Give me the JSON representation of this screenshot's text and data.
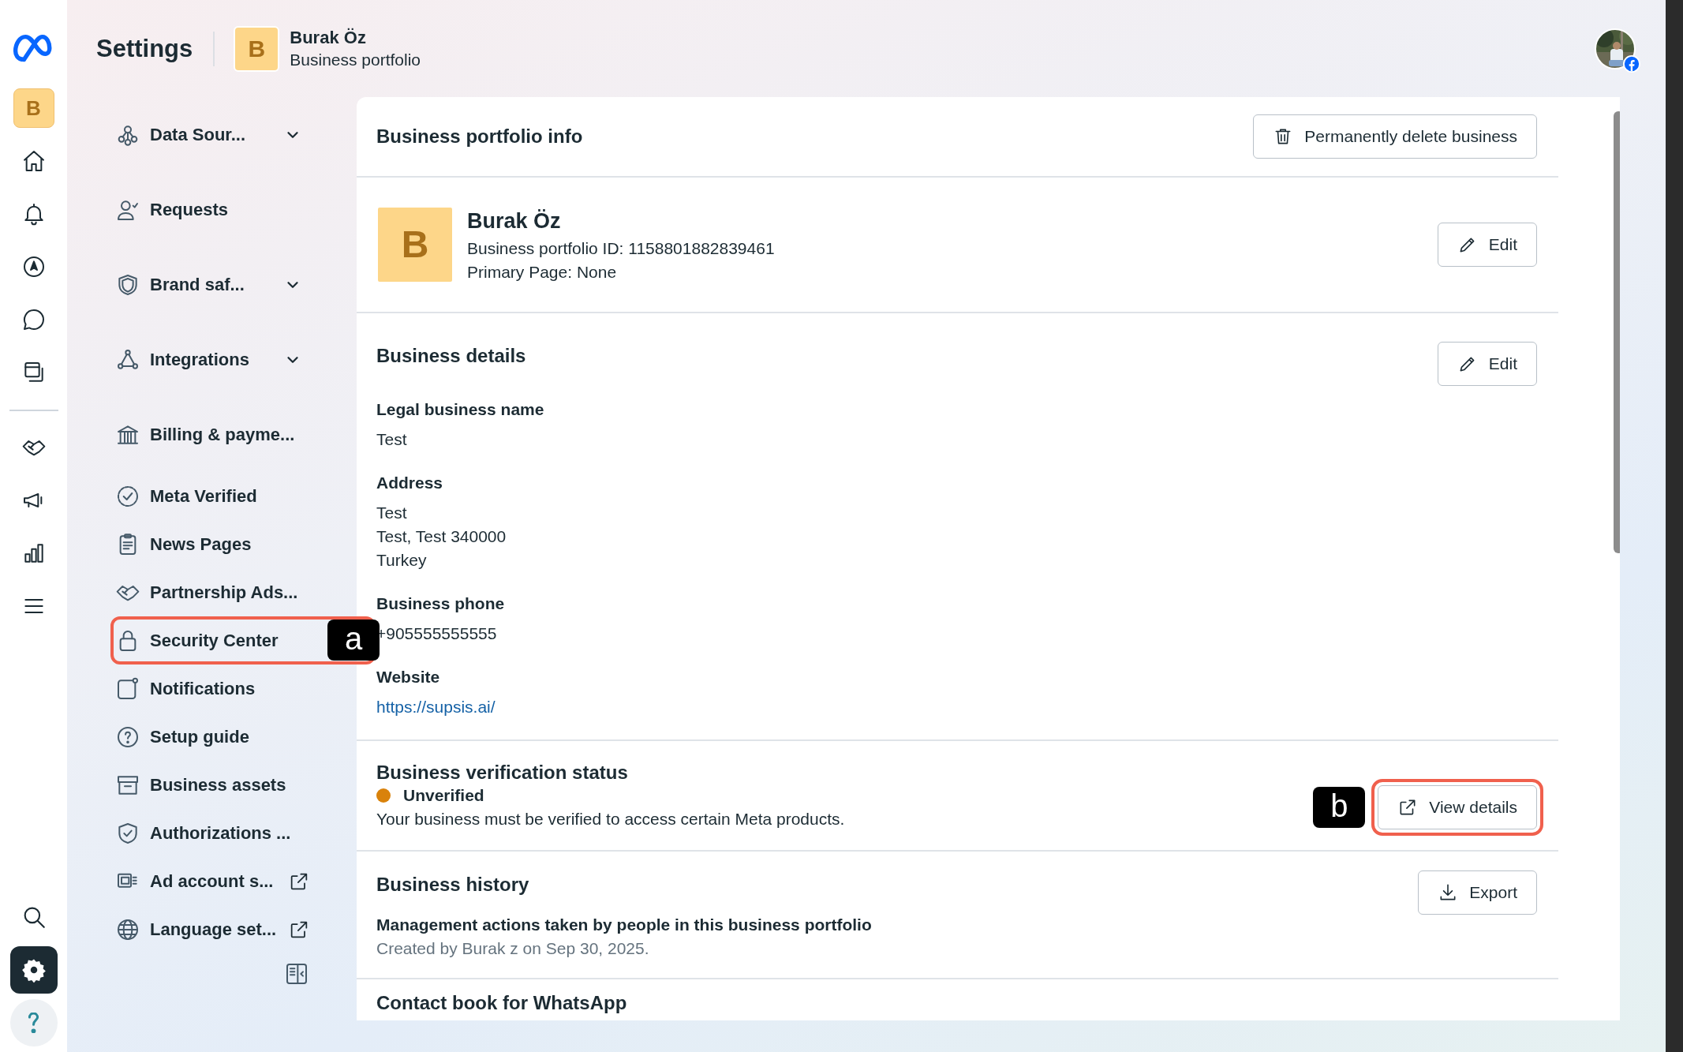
{
  "rail": {
    "badge": "B",
    "items": [
      {
        "selected": false
      },
      {
        "selected": false
      },
      {
        "selected": false
      },
      {
        "selected": false
      },
      {
        "selected": false
      },
      {
        "selected": false
      },
      {
        "selected": false
      },
      {
        "selected": false
      },
      {
        "selected": false
      }
    ],
    "bottom_items": [
      {
        "selected": false
      },
      {
        "selected": true
      },
      {
        "selected": false
      }
    ]
  },
  "header": {
    "title": "Settings",
    "business": {
      "initial": "B",
      "name": "Burak Öz",
      "subtitle": "Business portfolio"
    }
  },
  "sidebar": {
    "items": [
      {
        "label": "Data Sour...",
        "expandable": true,
        "external": false,
        "highlighted": false
      },
      {
        "label": "Requests",
        "expandable": false,
        "external": false,
        "highlighted": false
      },
      {
        "label": "Brand saf...",
        "expandable": true,
        "external": false,
        "highlighted": false
      },
      {
        "label": "Integrations",
        "expandable": true,
        "external": false,
        "highlighted": false
      },
      {
        "label": "Billing & payme...",
        "expandable": false,
        "external": false,
        "highlighted": false
      },
      {
        "label": "Meta Verified",
        "expandable": false,
        "external": false,
        "highlighted": false
      },
      {
        "label": "News Pages",
        "expandable": false,
        "external": false,
        "highlighted": false
      },
      {
        "label": "Partnership Ads...",
        "expandable": false,
        "external": false,
        "highlighted": false
      },
      {
        "label": "Security Center",
        "expandable": false,
        "external": false,
        "highlighted": true,
        "callout": "a"
      },
      {
        "label": "Notifications",
        "expandable": false,
        "external": false,
        "highlighted": false
      },
      {
        "label": "Setup guide",
        "expandable": false,
        "external": false,
        "highlighted": false
      },
      {
        "label": "Business assets",
        "expandable": false,
        "external": false,
        "highlighted": false
      },
      {
        "label": "Authorizations ...",
        "expandable": false,
        "external": false,
        "highlighted": false
      },
      {
        "label": "Ad account s...",
        "expandable": false,
        "external": true,
        "highlighted": false
      },
      {
        "label": "Language set...",
        "expandable": false,
        "external": true,
        "highlighted": false
      }
    ]
  },
  "portfolio_info": {
    "title": "Business portfolio info",
    "delete_button": "Permanently delete business"
  },
  "profile": {
    "initial": "B",
    "name": "Burak Öz",
    "id_line": "Business portfolio ID: 1158801882839461",
    "primary_page": "Primary Page: None",
    "edit_button": "Edit"
  },
  "business_details": {
    "title": "Business details",
    "edit_button": "Edit",
    "fields": [
      {
        "label": "Legal business name",
        "values": [
          "Test"
        ],
        "kind": "text"
      },
      {
        "label": "Address",
        "values": [
          "Test",
          "Test, Test 340000",
          "Turkey"
        ],
        "kind": "text"
      },
      {
        "label": "Business phone",
        "values": [
          "+905555555555"
        ],
        "kind": "text"
      },
      {
        "label": "Website",
        "values": [
          "https://supsis.ai/"
        ],
        "kind": "link"
      }
    ]
  },
  "verification": {
    "title": "Business verification status",
    "status": "Unverified",
    "color": "#d9820b",
    "description": "Your business must be verified to access certain Meta products.",
    "button": "View details",
    "highlighted": true,
    "callout": "b"
  },
  "history": {
    "title": "Business history",
    "button": "Export",
    "heading": "Management actions taken by people in this business portfolio",
    "meta": "Created by Burak z on Sep 30, 2025."
  },
  "contact_book": {
    "title": "Contact book for WhatsApp"
  }
}
